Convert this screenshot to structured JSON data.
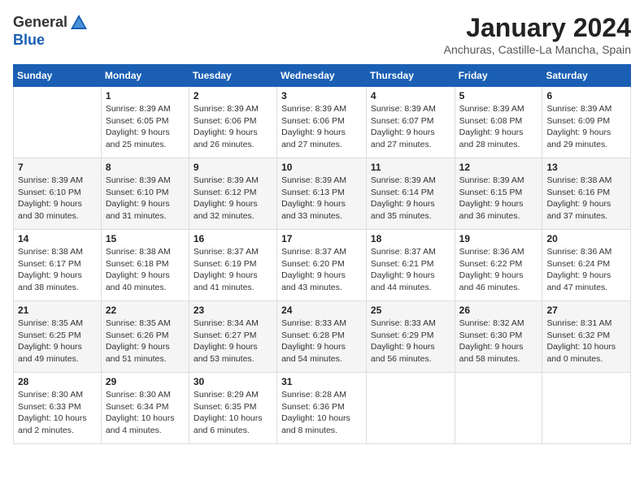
{
  "header": {
    "logo_general": "General",
    "logo_blue": "Blue",
    "month_year": "January 2024",
    "location": "Anchuras, Castille-La Mancha, Spain"
  },
  "weekdays": [
    "Sunday",
    "Monday",
    "Tuesday",
    "Wednesday",
    "Thursday",
    "Friday",
    "Saturday"
  ],
  "weeks": [
    [
      {
        "day": "",
        "sunrise": "",
        "sunset": "",
        "daylight": ""
      },
      {
        "day": "1",
        "sunrise": "Sunrise: 8:39 AM",
        "sunset": "Sunset: 6:05 PM",
        "daylight": "Daylight: 9 hours and 25 minutes."
      },
      {
        "day": "2",
        "sunrise": "Sunrise: 8:39 AM",
        "sunset": "Sunset: 6:06 PM",
        "daylight": "Daylight: 9 hours and 26 minutes."
      },
      {
        "day": "3",
        "sunrise": "Sunrise: 8:39 AM",
        "sunset": "Sunset: 6:06 PM",
        "daylight": "Daylight: 9 hours and 27 minutes."
      },
      {
        "day": "4",
        "sunrise": "Sunrise: 8:39 AM",
        "sunset": "Sunset: 6:07 PM",
        "daylight": "Daylight: 9 hours and 27 minutes."
      },
      {
        "day": "5",
        "sunrise": "Sunrise: 8:39 AM",
        "sunset": "Sunset: 6:08 PM",
        "daylight": "Daylight: 9 hours and 28 minutes."
      },
      {
        "day": "6",
        "sunrise": "Sunrise: 8:39 AM",
        "sunset": "Sunset: 6:09 PM",
        "daylight": "Daylight: 9 hours and 29 minutes."
      }
    ],
    [
      {
        "day": "7",
        "sunrise": "Sunrise: 8:39 AM",
        "sunset": "Sunset: 6:10 PM",
        "daylight": "Daylight: 9 hours and 30 minutes."
      },
      {
        "day": "8",
        "sunrise": "Sunrise: 8:39 AM",
        "sunset": "Sunset: 6:10 PM",
        "daylight": "Daylight: 9 hours and 31 minutes."
      },
      {
        "day": "9",
        "sunrise": "Sunrise: 8:39 AM",
        "sunset": "Sunset: 6:12 PM",
        "daylight": "Daylight: 9 hours and 32 minutes."
      },
      {
        "day": "10",
        "sunrise": "Sunrise: 8:39 AM",
        "sunset": "Sunset: 6:13 PM",
        "daylight": "Daylight: 9 hours and 33 minutes."
      },
      {
        "day": "11",
        "sunrise": "Sunrise: 8:39 AM",
        "sunset": "Sunset: 6:14 PM",
        "daylight": "Daylight: 9 hours and 35 minutes."
      },
      {
        "day": "12",
        "sunrise": "Sunrise: 8:39 AM",
        "sunset": "Sunset: 6:15 PM",
        "daylight": "Daylight: 9 hours and 36 minutes."
      },
      {
        "day": "13",
        "sunrise": "Sunrise: 8:38 AM",
        "sunset": "Sunset: 6:16 PM",
        "daylight": "Daylight: 9 hours and 37 minutes."
      }
    ],
    [
      {
        "day": "14",
        "sunrise": "Sunrise: 8:38 AM",
        "sunset": "Sunset: 6:17 PM",
        "daylight": "Daylight: 9 hours and 38 minutes."
      },
      {
        "day": "15",
        "sunrise": "Sunrise: 8:38 AM",
        "sunset": "Sunset: 6:18 PM",
        "daylight": "Daylight: 9 hours and 40 minutes."
      },
      {
        "day": "16",
        "sunrise": "Sunrise: 8:37 AM",
        "sunset": "Sunset: 6:19 PM",
        "daylight": "Daylight: 9 hours and 41 minutes."
      },
      {
        "day": "17",
        "sunrise": "Sunrise: 8:37 AM",
        "sunset": "Sunset: 6:20 PM",
        "daylight": "Daylight: 9 hours and 43 minutes."
      },
      {
        "day": "18",
        "sunrise": "Sunrise: 8:37 AM",
        "sunset": "Sunset: 6:21 PM",
        "daylight": "Daylight: 9 hours and 44 minutes."
      },
      {
        "day": "19",
        "sunrise": "Sunrise: 8:36 AM",
        "sunset": "Sunset: 6:22 PM",
        "daylight": "Daylight: 9 hours and 46 minutes."
      },
      {
        "day": "20",
        "sunrise": "Sunrise: 8:36 AM",
        "sunset": "Sunset: 6:24 PM",
        "daylight": "Daylight: 9 hours and 47 minutes."
      }
    ],
    [
      {
        "day": "21",
        "sunrise": "Sunrise: 8:35 AM",
        "sunset": "Sunset: 6:25 PM",
        "daylight": "Daylight: 9 hours and 49 minutes."
      },
      {
        "day": "22",
        "sunrise": "Sunrise: 8:35 AM",
        "sunset": "Sunset: 6:26 PM",
        "daylight": "Daylight: 9 hours and 51 minutes."
      },
      {
        "day": "23",
        "sunrise": "Sunrise: 8:34 AM",
        "sunset": "Sunset: 6:27 PM",
        "daylight": "Daylight: 9 hours and 53 minutes."
      },
      {
        "day": "24",
        "sunrise": "Sunrise: 8:33 AM",
        "sunset": "Sunset: 6:28 PM",
        "daylight": "Daylight: 9 hours and 54 minutes."
      },
      {
        "day": "25",
        "sunrise": "Sunrise: 8:33 AM",
        "sunset": "Sunset: 6:29 PM",
        "daylight": "Daylight: 9 hours and 56 minutes."
      },
      {
        "day": "26",
        "sunrise": "Sunrise: 8:32 AM",
        "sunset": "Sunset: 6:30 PM",
        "daylight": "Daylight: 9 hours and 58 minutes."
      },
      {
        "day": "27",
        "sunrise": "Sunrise: 8:31 AM",
        "sunset": "Sunset: 6:32 PM",
        "daylight": "Daylight: 10 hours and 0 minutes."
      }
    ],
    [
      {
        "day": "28",
        "sunrise": "Sunrise: 8:30 AM",
        "sunset": "Sunset: 6:33 PM",
        "daylight": "Daylight: 10 hours and 2 minutes."
      },
      {
        "day": "29",
        "sunrise": "Sunrise: 8:30 AM",
        "sunset": "Sunset: 6:34 PM",
        "daylight": "Daylight: 10 hours and 4 minutes."
      },
      {
        "day": "30",
        "sunrise": "Sunrise: 8:29 AM",
        "sunset": "Sunset: 6:35 PM",
        "daylight": "Daylight: 10 hours and 6 minutes."
      },
      {
        "day": "31",
        "sunrise": "Sunrise: 8:28 AM",
        "sunset": "Sunset: 6:36 PM",
        "daylight": "Daylight: 10 hours and 8 minutes."
      },
      {
        "day": "",
        "sunrise": "",
        "sunset": "",
        "daylight": ""
      },
      {
        "day": "",
        "sunrise": "",
        "sunset": "",
        "daylight": ""
      },
      {
        "day": "",
        "sunrise": "",
        "sunset": "",
        "daylight": ""
      }
    ]
  ]
}
